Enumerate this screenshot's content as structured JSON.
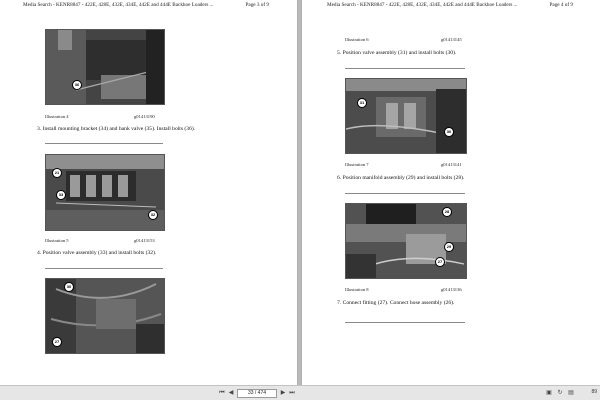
{
  "header": {
    "title": "Media Search - KENR8847 - 422E, 428E, 432E, 434E, 442E and 444E Backhoe Loaders ...",
    "left_page_label": "Page 3 of 9",
    "right_page_label": "Page 4 of 9"
  },
  "left_page": {
    "illustrations": [
      {
        "caption": "Illustration 4",
        "id": "g01413190",
        "callouts": [
          "36"
        ]
      },
      {
        "caption": "Illustration 5",
        "id": "g01413153",
        "callouts": [
          "21",
          "33",
          "32"
        ]
      },
      {
        "callouts": [
          "30",
          "27"
        ]
      }
    ],
    "steps": [
      "3.  Install mounting bracket (34) and bank valve (35). Install bolts (36).",
      "4.  Position valve assembly (33) and install bolts (32)."
    ]
  },
  "right_page": {
    "illustrations": [
      {
        "caption": "Illustration 6",
        "id": "g01413145"
      },
      {
        "caption": "Illustration 7",
        "id": "g01413141",
        "callouts": [
          "31",
          "30"
        ]
      },
      {
        "caption": "Illustration 8",
        "id": "g01413136",
        "callouts": [
          "28",
          "29",
          "27"
        ]
      }
    ],
    "steps": [
      "5.  Position valve assembly (31) and install bolts (30).",
      "6.  Position manifold assembly (29) and install bolts (28).",
      "7.  Connect fitting (27). Connect hose assembly (26)."
    ]
  },
  "toolbar": {
    "page_indicator": "33 / 474",
    "zoom": "89",
    "icons": [
      "first-page-icon",
      "prev-page-icon",
      "next-page-icon",
      "last-page-icon",
      "fit-icon",
      "rotate-icon"
    ]
  },
  "colors": {
    "background": "#b9b9b9",
    "page": "#ffffff",
    "photo": "#3d3d3d"
  }
}
